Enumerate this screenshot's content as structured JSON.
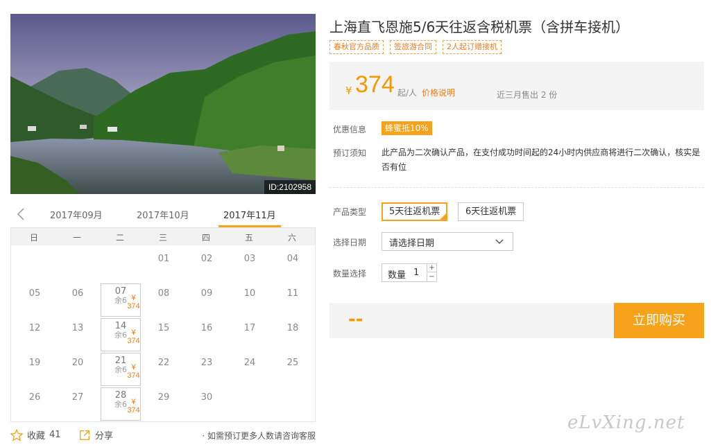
{
  "photo": {
    "id_label": "ID:2102958"
  },
  "calendar": {
    "months": [
      "2017年09月",
      "2017年10月",
      "2017年11月"
    ],
    "active_month_index": 2,
    "weekdays": [
      "日",
      "一",
      "二",
      "三",
      "四",
      "五",
      "六"
    ],
    "weeks": [
      [
        null,
        null,
        null,
        {
          "d": "01"
        },
        {
          "d": "02"
        },
        {
          "d": "03"
        },
        {
          "d": "04"
        }
      ],
      [
        {
          "d": "05"
        },
        {
          "d": "06"
        },
        {
          "d": "07",
          "price": "¥ 374",
          "left": "余6"
        },
        {
          "d": "08"
        },
        {
          "d": "09"
        },
        {
          "d": "10"
        },
        {
          "d": "11"
        }
      ],
      [
        {
          "d": "12"
        },
        {
          "d": "13"
        },
        {
          "d": "14",
          "price": "¥ 374",
          "left": "余6"
        },
        {
          "d": "15"
        },
        {
          "d": "16"
        },
        {
          "d": "17"
        },
        {
          "d": "18"
        }
      ],
      [
        {
          "d": "19"
        },
        {
          "d": "20"
        },
        {
          "d": "21",
          "price": "¥ 374",
          "left": "余6"
        },
        {
          "d": "22"
        },
        {
          "d": "23"
        },
        {
          "d": "24"
        },
        {
          "d": "25"
        }
      ],
      [
        {
          "d": "26"
        },
        {
          "d": "27"
        },
        {
          "d": "28",
          "price": "¥ 374",
          "left": "余6"
        },
        {
          "d": "29"
        },
        {
          "d": "30"
        },
        null,
        null
      ]
    ]
  },
  "footer": {
    "favorite_label": "收藏",
    "favorite_count": "41",
    "share_label": "分享",
    "note": "· 如需预订更多人数请咨询客服"
  },
  "product": {
    "title": "上海直飞恩施5/6天往返含税机票（含拼车接机）",
    "tags": [
      "春秋官方品质",
      "签旅游合同",
      "2人起订赠接机"
    ],
    "currency": "¥",
    "price": "374",
    "price_unit": "起/人",
    "price_link": "价格说明",
    "sold_text": "近三月售出 2 份"
  },
  "promo": {
    "label": "优惠信息",
    "badge": "蜂蜜抵10%"
  },
  "booking_notice": {
    "label": "预订须知",
    "text": "此产品为二次确认产品，在支付成功时间起的24小时内供应商将进行二次确认，核实是否有位"
  },
  "product_type": {
    "label": "产品类型",
    "options": [
      "5天往返机票",
      "6天往返机票"
    ],
    "selected_index": 0
  },
  "date_select": {
    "label": "选择日期",
    "value": "请选择日期"
  },
  "quantity": {
    "label": "数量选择",
    "field_label": "数量",
    "value": "1",
    "plus": "+",
    "minus": "−"
  },
  "buy": {
    "total": "--",
    "button": "立即购买"
  },
  "watermark": "eLvXing.net",
  "colors": {
    "accent": "#f7a21b",
    "price": "#f39800",
    "link": "#ee7c1b"
  }
}
